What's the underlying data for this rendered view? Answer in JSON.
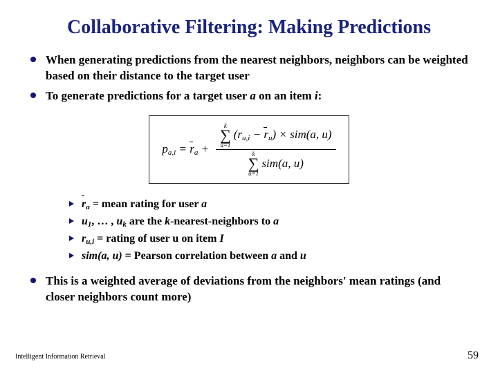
{
  "title": "Collaborative Filtering: Making Predictions",
  "bullets": {
    "b1": "When generating predictions from the nearest neighbors, neighbors can be weighted based on their distance to the target user",
    "b2_pre": "To generate predictions for a target user ",
    "b2_a": "a",
    "b2_mid": " on an item ",
    "b2_i": "i",
    "b2_post": ":"
  },
  "formula": {
    "lhs_p": "p",
    "lhs_sub": "a,i",
    "eq": " = ",
    "rbar": "r",
    "r_sub_a": "a",
    "plus": " + ",
    "sum_upper": "k",
    "sum_lower": "u=1",
    "sum_sym": "∑",
    "open": "(",
    "rui_r": "r",
    "rui_sub": "u,i",
    "minus": " − ",
    "ru_r": "r",
    "ru_sub": "u",
    "close": ")",
    "times": " × ",
    "sim": "sim",
    "sim_args": "(a, u)"
  },
  "defs": {
    "d1_rbar": "r",
    "d1_sub": "a",
    "d1_rest": " = mean rating for user ",
    "d1_a": "a",
    "d2_pre": "u",
    "d2_sub1": "1",
    "d2_mid": ", … , ",
    "d2_u2": "u",
    "d2_subk": "k",
    "d2_rest": " are the ",
    "d2_k": "k",
    "d2_post": "-nearest-neighbors to ",
    "d2_a": "a",
    "d3_r": "r",
    "d3_sub": "u,i",
    "d3_rest": " = rating of user u on item ",
    "d3_I": "I",
    "d4_sim": "sim(a, u)",
    "d4_rest": " = Pearson correlation between ",
    "d4_a": "a",
    "d4_and": " and ",
    "d4_u": "u"
  },
  "note": "This is a weighted average of deviations from the neighbors' mean ratings (and closer neighbors count more)",
  "footer": {
    "left": "Intelligent Information Retrieval",
    "right": "59"
  }
}
